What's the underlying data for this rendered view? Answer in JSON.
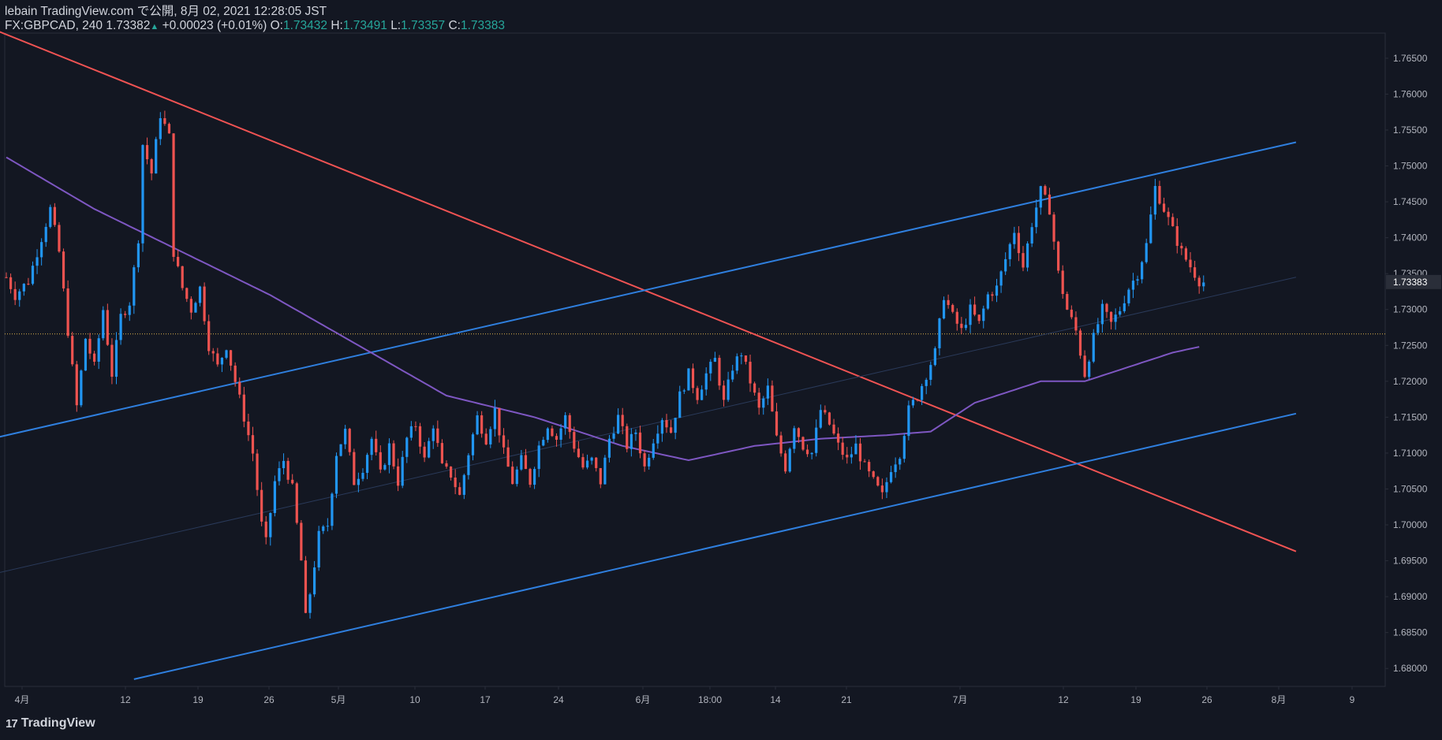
{
  "header": {
    "line1": "lebain TradingView.com で公開, 8月 02, 2021 12:28:05 JST",
    "symbol": "FX:GBPCAD, 240",
    "last": "1.73382",
    "change": "+0.00023 (+0.01%)",
    "o_label": "O:",
    "o": "1.73432",
    "h_label": "H:",
    "h": "1.73491",
    "l_label": "L:",
    "l": "1.73357",
    "c_label": "C:",
    "c": "1.73383"
  },
  "footer": {
    "brand": "TradingView",
    "mark": "17"
  },
  "colors": {
    "bg": "#131722",
    "up": "#2196f3",
    "down": "#ef5350",
    "ma": "#7e57c2",
    "trend_down": "#f05353",
    "channel": "#2f7fde",
    "hline": "#e0b44c",
    "price_tag": "#2a2e39"
  },
  "chart_data": {
    "type": "candlestick",
    "symbol": "FX:GBPCAD",
    "timeframe": "240",
    "ylim": [
      1.6775,
      1.7685
    ],
    "yticks": [
      "1.68000",
      "1.68500",
      "1.69000",
      "1.69500",
      "1.70000",
      "1.70500",
      "1.71000",
      "1.71500",
      "1.72000",
      "1.72500",
      "1.73000",
      "1.73500",
      "1.74000",
      "1.74500",
      "1.75000",
      "1.75500",
      "1.76000",
      "1.76500"
    ],
    "xticks": [
      "4月",
      "12",
      "19",
      "26",
      "5月",
      "10",
      "17",
      "24",
      "6月",
      "18:00",
      "14",
      "21",
      "7月",
      "12",
      "19",
      "26",
      "8月",
      "9"
    ],
    "last_price_label": "1.73383",
    "price_keypoints": [
      [
        0,
        1.7345
      ],
      [
        2,
        1.732
      ],
      [
        5,
        1.734
      ],
      [
        8,
        1.74
      ],
      [
        10,
        1.744
      ],
      [
        12,
        1.738
      ],
      [
        14,
        1.727
      ],
      [
        16,
        1.7165
      ],
      [
        18,
        1.726
      ],
      [
        20,
        1.722
      ],
      [
        22,
        1.73
      ],
      [
        24,
        1.721
      ],
      [
        26,
        1.729
      ],
      [
        28,
        1.731
      ],
      [
        30,
        1.74
      ],
      [
        31,
        1.753
      ],
      [
        33,
        1.749
      ],
      [
        35,
        1.7572
      ],
      [
        37,
        1.754
      ],
      [
        38,
        1.738
      ],
      [
        40,
        1.733
      ],
      [
        42,
        1.73
      ],
      [
        44,
        1.733
      ],
      [
        46,
        1.725
      ],
      [
        48,
        1.722
      ],
      [
        50,
        1.725
      ],
      [
        52,
        1.72
      ],
      [
        54,
        1.715
      ],
      [
        56,
        1.71
      ],
      [
        58,
        1.7
      ],
      [
        59,
        1.6975
      ],
      [
        61,
        1.706
      ],
      [
        63,
        1.709
      ],
      [
        65,
        1.705
      ],
      [
        67,
        1.695
      ],
      [
        68,
        1.687
      ],
      [
        69,
        1.6905
      ],
      [
        71,
        1.6985
      ],
      [
        73,
        1.7
      ],
      [
        75,
        1.71
      ],
      [
        77,
        1.713
      ],
      [
        79,
        1.706
      ],
      [
        81,
        1.708
      ],
      [
        83,
        1.712
      ],
      [
        85,
        1.707
      ],
      [
        87,
        1.711
      ],
      [
        89,
        1.706
      ],
      [
        91,
        1.712
      ],
      [
        93,
        1.714
      ],
      [
        95,
        1.709
      ],
      [
        97,
        1.714
      ],
      [
        99,
        1.708
      ],
      [
        101,
        1.707
      ],
      [
        103,
        1.704
      ],
      [
        105,
        1.71
      ],
      [
        107,
        1.715
      ],
      [
        109,
        1.712
      ],
      [
        111,
        1.716
      ],
      [
        113,
        1.71
      ],
      [
        115,
        1.706
      ],
      [
        117,
        1.709
      ],
      [
        119,
        1.706
      ],
      [
        121,
        1.711
      ],
      [
        123,
        1.714
      ],
      [
        125,
        1.712
      ],
      [
        127,
        1.715
      ],
      [
        129,
        1.711
      ],
      [
        131,
        1.708
      ],
      [
        133,
        1.709
      ],
      [
        135,
        1.706
      ],
      [
        137,
        1.712
      ],
      [
        139,
        1.715
      ],
      [
        141,
        1.711
      ],
      [
        143,
        1.713
      ],
      [
        145,
        1.708
      ],
      [
        147,
        1.712
      ],
      [
        149,
        1.715
      ],
      [
        151,
        1.713
      ],
      [
        153,
        1.718
      ],
      [
        155,
        1.721
      ],
      [
        157,
        1.718
      ],
      [
        159,
        1.721
      ],
      [
        161,
        1.723
      ],
      [
        163,
        1.717
      ],
      [
        165,
        1.722
      ],
      [
        167,
        1.724
      ],
      [
        169,
        1.72
      ],
      [
        171,
        1.716
      ],
      [
        173,
        1.719
      ],
      [
        175,
        1.712
      ],
      [
        177,
        1.708
      ],
      [
        179,
        1.714
      ],
      [
        181,
        1.711
      ],
      [
        183,
        1.71
      ],
      [
        185,
        1.716
      ],
      [
        187,
        1.714
      ],
      [
        189,
        1.711
      ],
      [
        191,
        1.709
      ],
      [
        193,
        1.711
      ],
      [
        195,
        1.708
      ],
      [
        197,
        1.706
      ],
      [
        199,
        1.704
      ],
      [
        201,
        1.708
      ],
      [
        203,
        1.71
      ],
      [
        205,
        1.716
      ],
      [
        207,
        1.718
      ],
      [
        209,
        1.721
      ],
      [
        211,
        1.724
      ],
      [
        213,
        1.732
      ],
      [
        215,
        1.729
      ],
      [
        217,
        1.727
      ],
      [
        219,
        1.73
      ],
      [
        221,
        1.728
      ],
      [
        223,
        1.732
      ],
      [
        225,
        1.733
      ],
      [
        227,
        1.737
      ],
      [
        229,
        1.741
      ],
      [
        231,
        1.736
      ],
      [
        233,
        1.742
      ],
      [
        235,
        1.7465
      ],
      [
        237,
        1.744
      ],
      [
        239,
        1.735
      ],
      [
        241,
        1.73
      ],
      [
        243,
        1.727
      ],
      [
        245,
        1.721
      ],
      [
        247,
        1.726
      ],
      [
        249,
        1.73
      ],
      [
        251,
        1.728
      ],
      [
        253,
        1.73
      ],
      [
        255,
        1.733
      ],
      [
        257,
        1.735
      ],
      [
        259,
        1.739
      ],
      [
        261,
        1.747
      ],
      [
        263,
        1.744
      ],
      [
        265,
        1.741
      ],
      [
        267,
        1.738
      ],
      [
        269,
        1.736
      ],
      [
        271,
        1.734
      ],
      [
        272,
        1.7338
      ]
    ],
    "ma_keypoints": [
      [
        0,
        1.7512
      ],
      [
        20,
        1.744
      ],
      [
        40,
        1.738
      ],
      [
        60,
        1.732
      ],
      [
        80,
        1.725
      ],
      [
        100,
        1.718
      ],
      [
        120,
        1.715
      ],
      [
        140,
        1.711
      ],
      [
        155,
        1.709
      ],
      [
        170,
        1.711
      ],
      [
        185,
        1.712
      ],
      [
        200,
        1.7125
      ],
      [
        210,
        1.713
      ],
      [
        220,
        1.717
      ],
      [
        235,
        1.72
      ],
      [
        245,
        1.72
      ],
      [
        255,
        1.722
      ],
      [
        265,
        1.724
      ],
      [
        271,
        1.7248
      ]
    ],
    "trendlines": [
      {
        "name": "downtrend",
        "color": "#f05353",
        "from": [
          -2,
          1.7688
        ],
        "to": [
          293,
          1.6963
        ]
      },
      {
        "name": "channel-upper",
        "color": "#2f7fde",
        "from": [
          -2,
          1.7122
        ],
        "to": [
          293,
          1.7533
        ]
      },
      {
        "name": "channel-lower",
        "color": "#2f7fde",
        "from": [
          29,
          1.6785
        ],
        "to": [
          293,
          1.7155
        ]
      },
      {
        "name": "channel-mid-thin",
        "color": "#2a3a5a",
        "from": [
          -2,
          1.6933
        ],
        "to": [
          293,
          1.7345
        ]
      }
    ],
    "horizontal_line": {
      "value": 1.7266,
      "style": "dotted",
      "color": "#e0b44c"
    },
    "last_price": 1.73383,
    "grid": false
  }
}
